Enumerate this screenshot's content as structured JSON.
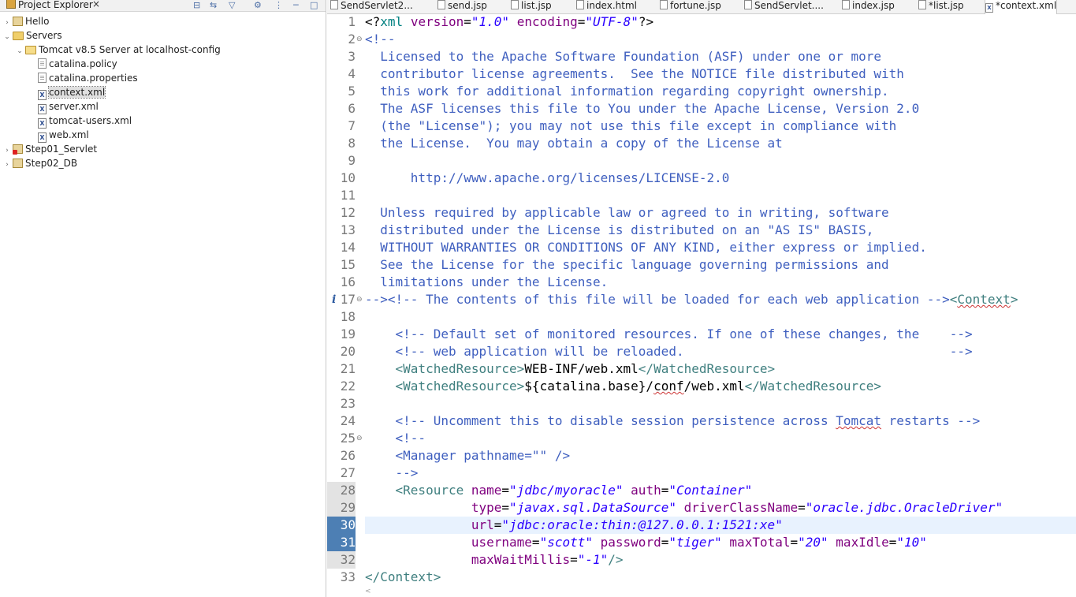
{
  "explorer": {
    "title": "Project Explorer",
    "close": "×",
    "toolbar": [
      {
        "name": "collapse-all-icon",
        "glyph": "⊟"
      },
      {
        "name": "link-with-editor-icon",
        "glyph": "⇆"
      },
      {
        "name": "filter-icon",
        "glyph": "▽"
      },
      {
        "name": "focus-icon",
        "glyph": "⚙"
      },
      {
        "name": "view-menu-icon",
        "glyph": "⋮"
      },
      {
        "name": "minimize-icon",
        "glyph": "─"
      },
      {
        "name": "maximize-icon",
        "glyph": "□"
      }
    ],
    "tree": [
      {
        "label": "Hello",
        "icon": "project-icon",
        "twisty": "›",
        "level": 0
      },
      {
        "label": "Servers",
        "icon": "folder-icon",
        "twisty": "⌄",
        "level": 0
      },
      {
        "label": "Tomcat v8.5 Server at localhost-config",
        "icon": "open-folder-icon",
        "twisty": "⌄",
        "level": 1
      },
      {
        "label": "catalina.policy",
        "icon": "file-icon",
        "twisty": "",
        "level": 2
      },
      {
        "label": "catalina.properties",
        "icon": "file-icon",
        "twisty": "",
        "level": 2
      },
      {
        "label": "context.xml",
        "icon": "xml-file-icon",
        "twisty": "",
        "level": 2,
        "selected": true
      },
      {
        "label": "server.xml",
        "icon": "xml-file-icon",
        "twisty": "",
        "level": 2
      },
      {
        "label": "tomcat-users.xml",
        "icon": "xml-file-icon",
        "twisty": "",
        "level": 2
      },
      {
        "label": "web.xml",
        "icon": "xml-file-icon",
        "twisty": "",
        "level": 2
      },
      {
        "label": "Step01_Servlet",
        "icon": "project-error-icon",
        "twisty": "›",
        "level": 0
      },
      {
        "label": "Step02_DB",
        "icon": "project-icon",
        "twisty": "›",
        "level": 0
      }
    ]
  },
  "editor_tabs": [
    {
      "label": "SendServlet2...",
      "type": "java"
    },
    {
      "label": "send.jsp",
      "type": "jsp"
    },
    {
      "label": "list.jsp",
      "type": "jsp"
    },
    {
      "label": "index.html",
      "type": "html"
    },
    {
      "label": "fortune.jsp",
      "type": "jsp"
    },
    {
      "label": "SendServlet....",
      "type": "java"
    },
    {
      "label": "index.jsp",
      "type": "jsp"
    },
    {
      "label": "*list.jsp",
      "type": "jsp"
    },
    {
      "label": "*context.xml",
      "type": "xml",
      "active": true
    }
  ],
  "code": [
    {
      "n": "1",
      "segs": [
        [
          "t",
          "<?"
        ],
        [
          "pi",
          "xml"
        ],
        [
          "t",
          " "
        ],
        [
          "at",
          "version"
        ],
        [
          "t",
          "="
        ],
        [
          "st",
          "\"1.0\""
        ],
        [
          "t",
          " "
        ],
        [
          "at",
          "encoding"
        ],
        [
          "t",
          "="
        ],
        [
          "st",
          "\"UTF-8\""
        ],
        [
          "t",
          "?>"
        ]
      ]
    },
    {
      "n": "2",
      "fold": "⊖",
      "segs": [
        [
          "cm",
          "<!--"
        ]
      ]
    },
    {
      "n": "3",
      "segs": [
        [
          "cm",
          "  Licensed to the Apache Software Foundation (ASF) under one or more"
        ]
      ]
    },
    {
      "n": "4",
      "segs": [
        [
          "cm",
          "  contributor license agreements.  See the NOTICE file distributed with"
        ]
      ]
    },
    {
      "n": "5",
      "segs": [
        [
          "cm",
          "  this work for additional information regarding copyright ownership."
        ]
      ]
    },
    {
      "n": "6",
      "segs": [
        [
          "cm",
          "  The ASF licenses this file to You under the Apache License, Version 2.0"
        ]
      ]
    },
    {
      "n": "7",
      "segs": [
        [
          "cm",
          "  (the \"License\"); you may not use this file except in compliance with"
        ]
      ]
    },
    {
      "n": "8",
      "segs": [
        [
          "cm",
          "  the License.  You may obtain a copy of the License at"
        ]
      ]
    },
    {
      "n": "9",
      "segs": []
    },
    {
      "n": "10",
      "segs": [
        [
          "cm",
          "      http://www.apache.org/licenses/LICENSE-2.0"
        ]
      ]
    },
    {
      "n": "11",
      "segs": []
    },
    {
      "n": "12",
      "segs": [
        [
          "cm",
          "  Unless required by applicable law or agreed to in writing, software"
        ]
      ]
    },
    {
      "n": "13",
      "segs": [
        [
          "cm",
          "  distributed under the License is distributed on an \"AS IS\" BASIS,"
        ]
      ]
    },
    {
      "n": "14",
      "segs": [
        [
          "cm",
          "  WITHOUT WARRANTIES OR CONDITIONS OF ANY KIND, either express or implied."
        ]
      ]
    },
    {
      "n": "15",
      "segs": [
        [
          "cm",
          "  See the License for the specific language governing permissions and"
        ]
      ]
    },
    {
      "n": "16",
      "segs": [
        [
          "cm",
          "  limitations under the License."
        ]
      ]
    },
    {
      "n": "17",
      "fold": "⊖",
      "marker": "i",
      "segs": [
        [
          "cm",
          "--><!-- The contents of this file will be loaded for each web application -->"
        ],
        [
          "tg",
          "<"
        ],
        [
          "tgsq",
          "Context"
        ],
        [
          "tg",
          ">"
        ]
      ]
    },
    {
      "n": "18",
      "segs": []
    },
    {
      "n": "19",
      "segs": [
        [
          "cm",
          "    <!-- Default set of monitored resources. If one of these changes, the    -->"
        ]
      ]
    },
    {
      "n": "20",
      "segs": [
        [
          "cm",
          "    <!-- web application will be reloaded.                                   -->"
        ]
      ]
    },
    {
      "n": "21",
      "segs": [
        [
          "t",
          "    "
        ],
        [
          "tg",
          "<WatchedResource>"
        ],
        [
          "t",
          "WEB-INF/web.xml"
        ],
        [
          "tg",
          "</WatchedResource>"
        ]
      ]
    },
    {
      "n": "22",
      "segs": [
        [
          "t",
          "    "
        ],
        [
          "tg",
          "<WatchedResource>"
        ],
        [
          "t",
          "${catalina.base}/"
        ],
        [
          "tsq",
          "conf"
        ],
        [
          "t",
          "/web.xml"
        ],
        [
          "tg",
          "</WatchedResource>"
        ]
      ]
    },
    {
      "n": "23",
      "segs": []
    },
    {
      "n": "24",
      "segs": [
        [
          "cm",
          "    <!-- Uncomment this to disable session persistence across "
        ],
        [
          "cmsq",
          "Tomcat"
        ],
        [
          "cm",
          " restarts -->"
        ]
      ]
    },
    {
      "n": "25",
      "fold": "⊖",
      "segs": [
        [
          "cm",
          "    <!--"
        ]
      ]
    },
    {
      "n": "26",
      "segs": [
        [
          "cm",
          "    <Manager pathname=\"\" />"
        ]
      ]
    },
    {
      "n": "27",
      "segs": [
        [
          "cm",
          "    -->"
        ]
      ]
    },
    {
      "n": "28",
      "band": true,
      "segs": [
        [
          "t",
          "    "
        ],
        [
          "tg",
          "<Resource "
        ],
        [
          "at",
          "name"
        ],
        [
          "t",
          "="
        ],
        [
          "st",
          "\"jdbc/myoracle\""
        ],
        [
          "t",
          " "
        ],
        [
          "at",
          "auth"
        ],
        [
          "t",
          "="
        ],
        [
          "st",
          "\"Container\""
        ]
      ]
    },
    {
      "n": "29",
      "band": true,
      "segs": [
        [
          "t",
          "              "
        ],
        [
          "at",
          "type"
        ],
        [
          "t",
          "="
        ],
        [
          "st",
          "\"javax.sql.DataSource\""
        ],
        [
          "t",
          " "
        ],
        [
          "at",
          "driverClassName"
        ],
        [
          "t",
          "="
        ],
        [
          "st",
          "\"oracle.jdbc.OracleDriver\""
        ]
      ]
    },
    {
      "n": "30",
      "sel": true,
      "current": true,
      "segs": [
        [
          "t",
          "              "
        ],
        [
          "at",
          "url"
        ],
        [
          "t",
          "="
        ],
        [
          "st",
          "\"jdbc:oracle:thin:@127.0.0.1:1521:xe\""
        ]
      ]
    },
    {
      "n": "31",
      "sel": true,
      "segs": [
        [
          "t",
          "              "
        ],
        [
          "at",
          "username"
        ],
        [
          "t",
          "="
        ],
        [
          "st",
          "\"scott\""
        ],
        [
          "t",
          " "
        ],
        [
          "at",
          "password"
        ],
        [
          "t",
          "="
        ],
        [
          "st",
          "\"tiger\""
        ],
        [
          "t",
          " "
        ],
        [
          "at",
          "maxTotal"
        ],
        [
          "t",
          "="
        ],
        [
          "st",
          "\"20\""
        ],
        [
          "t",
          " "
        ],
        [
          "at",
          "maxIdle"
        ],
        [
          "t",
          "="
        ],
        [
          "st",
          "\"10\""
        ]
      ]
    },
    {
      "n": "32",
      "band": true,
      "segs": [
        [
          "t",
          "              "
        ],
        [
          "at",
          "maxWaitMillis"
        ],
        [
          "t",
          "="
        ],
        [
          "st",
          "\"-1\""
        ],
        [
          "tg",
          "/>"
        ]
      ]
    },
    {
      "n": "33",
      "segs": [
        [
          "tg",
          "</Context>"
        ]
      ]
    }
  ]
}
